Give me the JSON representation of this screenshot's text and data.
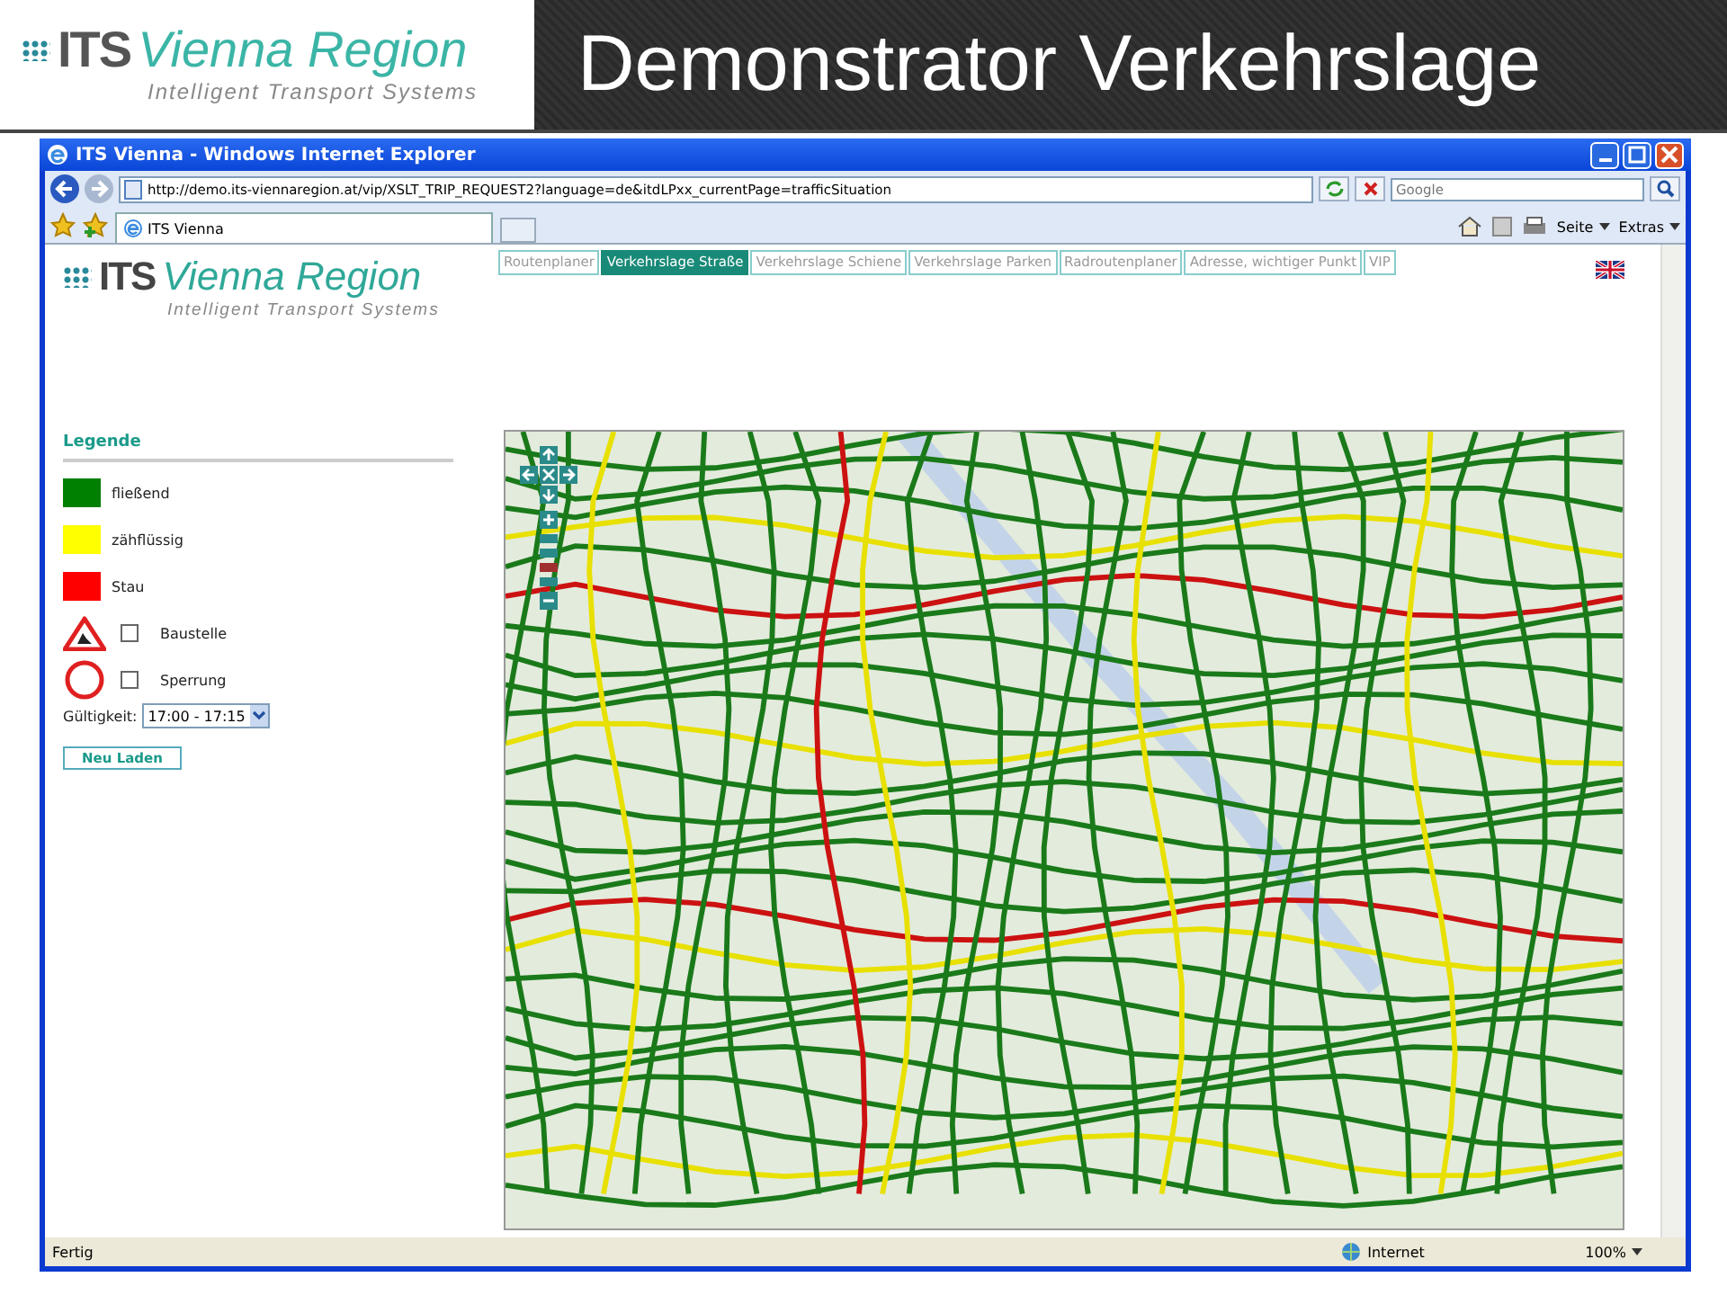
{
  "slide": {
    "logo": {
      "brand": "ITS",
      "name": "Vienna Region",
      "tagline": "Intelligent Transport Systems"
    },
    "title": "Demonstrator Verkehrslage"
  },
  "browser": {
    "title": "ITS Vienna - Windows Internet Explorer",
    "address": "http://demo.its-viennaregion.at/vip/XSLT_TRIP_REQUEST2?language=de&itdLPxx_currentPage=trafficSituation",
    "search_placeholder": "Google",
    "tabs": [
      {
        "label": "ITS Vienna",
        "selected": true
      }
    ],
    "commands": [
      "Seite",
      "Extras"
    ],
    "status": "Fertig",
    "zone": "Internet",
    "zoom": "100%"
  },
  "page": {
    "logo": {
      "brand": "ITS",
      "name": "Vienna Region",
      "tagline": "Intelligent Transport Systems"
    },
    "nav": [
      {
        "label": "Routenplaner",
        "selected": false
      },
      {
        "label": "Verkehrslage Straße",
        "selected": true
      },
      {
        "label": "Verkehrslage Schiene",
        "selected": false
      },
      {
        "label": "Verkehrslage Parken",
        "selected": false
      },
      {
        "label": "Radroutenplaner",
        "selected": false
      },
      {
        "label": "Adresse, wichtiger Punkt",
        "selected": false
      },
      {
        "label": "VIP",
        "selected": false
      }
    ],
    "legend": {
      "title": "Legende",
      "items": [
        {
          "kind": "swatch",
          "color": "#008000",
          "label": "fließend"
        },
        {
          "kind": "swatch",
          "color": "#ffff00",
          "label": "zähflüssig"
        },
        {
          "kind": "swatch",
          "color": "#ff0000",
          "label": "Stau"
        },
        {
          "kind": "roadworks",
          "label": "Baustelle",
          "checked": false
        },
        {
          "kind": "closure",
          "label": "Sperrung",
          "checked": false
        }
      ]
    },
    "validity": {
      "label": "Gültigkeit:",
      "value": "17:00 - 17:15"
    },
    "reload": "Neu Laden"
  }
}
